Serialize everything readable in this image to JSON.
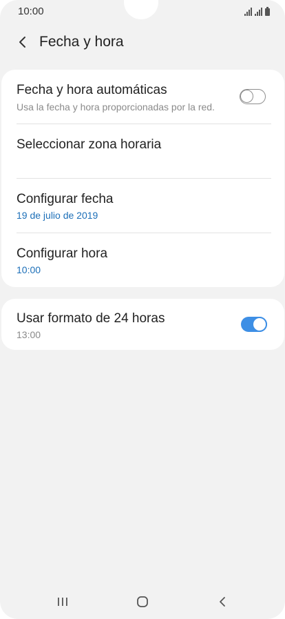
{
  "status_bar": {
    "time": "10:00"
  },
  "header": {
    "title": "Fecha y hora"
  },
  "settings": {
    "auto_datetime": {
      "title": "Fecha y hora automáticas",
      "subtitle": "Usa la fecha y hora proporcionadas por la red.",
      "enabled": false
    },
    "timezone": {
      "title": "Seleccionar zona horaria"
    },
    "set_date": {
      "title": "Configurar fecha",
      "value": "19 de julio de 2019"
    },
    "set_time": {
      "title": "Configurar hora",
      "value": "10:00"
    },
    "format_24h": {
      "title": "Usar formato de 24 horas",
      "subtitle": "13:00",
      "enabled": true
    }
  },
  "colors": {
    "accent": "#3e8fe5",
    "value_text": "#1c6fb8",
    "background": "#f2f2f2",
    "card": "#ffffff"
  },
  "icons": {
    "back": "chevron-left-icon",
    "nav_recent": "recent-apps-icon",
    "nav_home": "home-icon",
    "nav_back": "nav-back-icon"
  }
}
